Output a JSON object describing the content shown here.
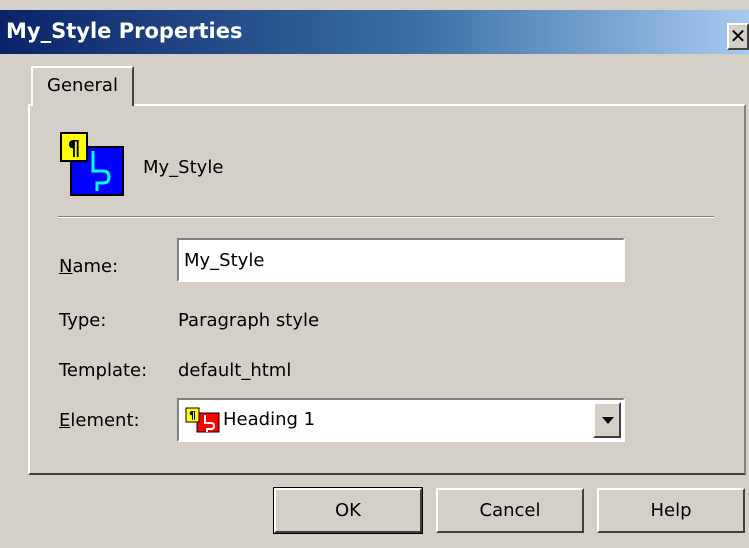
{
  "window": {
    "title": "My_Style Properties",
    "close_glyph": "✕"
  },
  "tabs": [
    {
      "label": "General",
      "selected": true
    }
  ],
  "header": {
    "icon": "paragraph-style-icon",
    "style_name": "My_Style"
  },
  "fields": {
    "name": {
      "label_underlined": "N",
      "label_rest": "ame:",
      "value": "My_Style"
    },
    "type": {
      "label": "Type:",
      "value": "Paragraph style"
    },
    "template": {
      "label": "Template:",
      "value": "default_html"
    },
    "element": {
      "label_underlined": "E",
      "label_rest": "lement:",
      "selected": "Heading 1",
      "icon": "paragraph-style-icon"
    }
  },
  "buttons": {
    "ok": "OK",
    "cancel": "Cancel",
    "help": "Help"
  },
  "colors": {
    "titlebar_start": "#0a246a",
    "titlebar_end": "#a6caf0",
    "dialog_face": "#d4d0c8"
  }
}
